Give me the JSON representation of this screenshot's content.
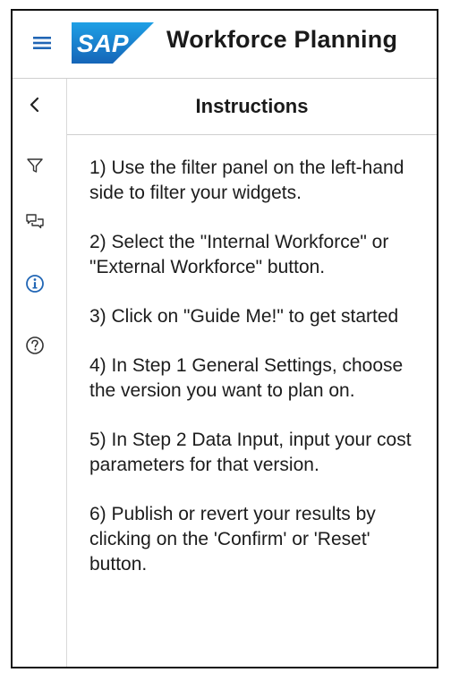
{
  "header": {
    "logo_text": "SAP",
    "app_title": "Workforce Planning",
    "menu_icon": "hamburger-menu-icon"
  },
  "side_rail": {
    "items": [
      {
        "name": "back",
        "icon": "chevron-left-icon"
      },
      {
        "name": "filter",
        "icon": "filter-icon"
      },
      {
        "name": "comments",
        "icon": "comments-icon"
      },
      {
        "name": "info",
        "icon": "info-icon",
        "active": true
      },
      {
        "name": "help",
        "icon": "help-icon"
      }
    ]
  },
  "panel": {
    "title": "Instructions",
    "steps": [
      "1) Use the filter panel on the left-hand side to filter your widgets.",
      "2) Select the \"Internal Workforce\" or \"External Workforce\" button.",
      "3) Click on \"Guide Me!\" to get started",
      "4) In Step 1 General Settings, choose the version you want to plan on.",
      "5) In Step 2 Data Input, input your cost parameters for that version.",
      "6) Publish or revert your results by clicking on the 'Confirm' or 'Reset' button."
    ]
  },
  "colors": {
    "brand_blue": "#1a73c9",
    "accent_blue": "#2166b5",
    "text": "#1c1c1c",
    "divider": "#cfcfcf"
  }
}
